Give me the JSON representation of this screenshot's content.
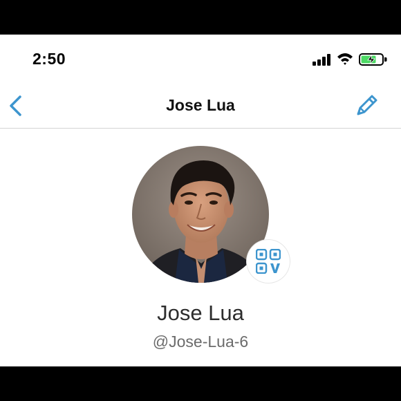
{
  "status_bar": {
    "time": "2:50",
    "icons": [
      "cellular-signal-icon",
      "wifi-icon",
      "battery-charging-icon"
    ]
  },
  "nav": {
    "title": "Jose Lua",
    "back_icon": "chevron-left-icon",
    "edit_icon": "pencil-icon"
  },
  "profile": {
    "name": "Jose Lua",
    "handle": "@Jose-Lua-6",
    "avatar_icon": "profile-photo",
    "badge_icon": "qr-code-icon"
  },
  "colors": {
    "accent": "#3d95ce",
    "title_text": "#111111",
    "name_text": "#2d2d2d",
    "handle_text": "#6b6b6b",
    "battery_fill": "#4cd964"
  }
}
